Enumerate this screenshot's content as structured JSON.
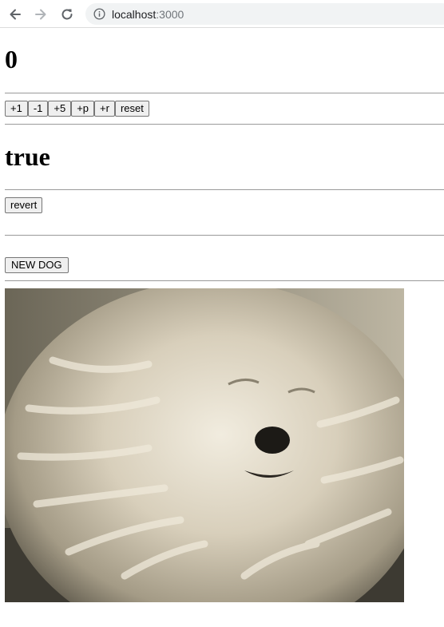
{
  "browser": {
    "url_host": "localhost",
    "url_port": ":3000",
    "icons": {
      "back": "arrow-left-icon",
      "forward": "arrow-right-icon",
      "reload": "reload-icon",
      "info": "info-icon"
    }
  },
  "counter": {
    "value": "0",
    "buttons": [
      "+1",
      "-1",
      "+5",
      "+p",
      "+r",
      "reset"
    ]
  },
  "toggle": {
    "value": "true",
    "revert_label": "revert"
  },
  "dog": {
    "button_label": "NEW DOG",
    "image_description": "sepia photo of a shaggy corded dog"
  },
  "colors": {
    "omnibox_bg": "#f1f3f4",
    "rule": "#9a9a9a",
    "button_bg": "#efefef"
  }
}
